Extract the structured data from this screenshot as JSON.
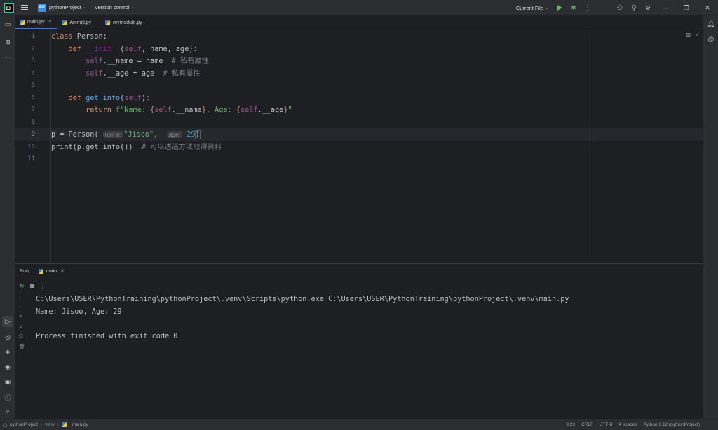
{
  "titlebar": {
    "logo_text": "IJ",
    "project_badge": "PP",
    "project_name": "pythonProject",
    "vcs_label": "Version control",
    "run_config": "Current File"
  },
  "tabs": [
    {
      "label": "main.py",
      "active": true
    },
    {
      "label": "Animal.py",
      "active": false
    },
    {
      "label": "mymodule.py",
      "active": false
    }
  ],
  "editor": {
    "line_numbers": [
      "1",
      "2",
      "3",
      "4",
      "5",
      "6",
      "7",
      "8",
      "9",
      "10",
      "11"
    ],
    "current_line": 9,
    "lines": {
      "l1_kw": "class",
      "l1_rest": " Person:",
      "l2_def": "def",
      "l2_name": "__init__",
      "l2_open": "(",
      "l2_self": "self",
      "l2_rest": ", name, age):",
      "l3_self": "self",
      "l3_rest": ".__name = name  ",
      "l3_cmt": "# 私有屬性",
      "l4_self": "self",
      "l4_rest": ".__age = age  ",
      "l4_cmt": "# 私有屬性",
      "l6_def": "def",
      "l6_name": "get_info",
      "l6_open": "(",
      "l6_self": "self",
      "l6_close": "):",
      "l7_return": "return",
      "l7_str1": "f\"Name: ",
      "l7_brace1": "{",
      "l7_self1": "self",
      "l7_expr1": ".__name",
      "l7_brace2": "}",
      "l7_str2": ", Age: ",
      "l7_brace3": "{",
      "l7_self2": "self",
      "l7_expr2": ".__age",
      "l7_brace4": "}",
      "l7_str3": "\"",
      "l9_a": "p = Person(",
      "l9_hint1": "name:",
      "l9_str": "\"Jisoo\"",
      "l9_comma": ",",
      "l9_hint2": "age:",
      "l9_num": "29",
      "l9_close": ")",
      "l10_a": "print(p.get_info())  ",
      "l10_cmt": "# 可以透過方法取得資料"
    }
  },
  "run_panel": {
    "title": "Run",
    "tab_label": "main",
    "console": [
      "C:\\Users\\USER\\PythonTraining\\pythonProject\\.venv\\Scripts\\python.exe C:\\Users\\USER\\PythonTraining\\pythonProject\\.venv\\main.py",
      "Name: Jisoo, Age: 29",
      "",
      "Process finished with exit code 0"
    ]
  },
  "statusbar": {
    "crumbs": [
      "pythonProject",
      "venv",
      "main.py"
    ],
    "position": "9:23",
    "line_sep": "CRLF",
    "encoding": "UTF-8",
    "indent": "4 spaces",
    "interpreter": "Python 3.12 (pythonProject)"
  },
  "colors": {
    "accent": "#3574f0",
    "keyword": "#cf8e6d",
    "string": "#6aab73",
    "function": "#56a8f5",
    "number": "#2aacb8"
  }
}
